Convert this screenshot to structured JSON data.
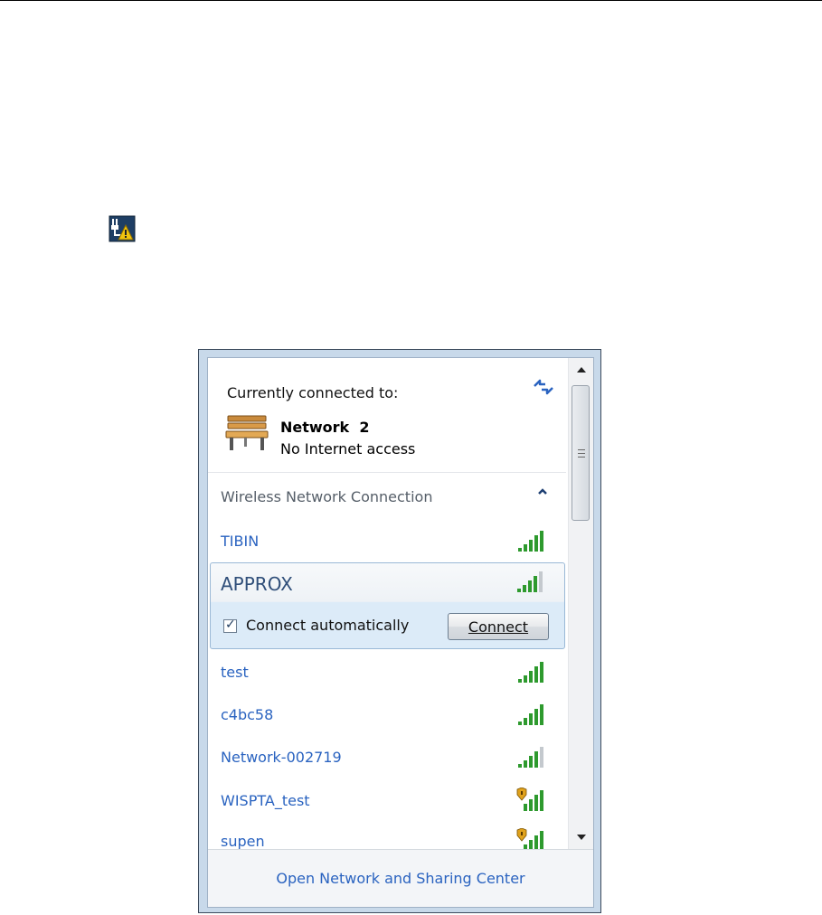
{
  "flyout": {
    "currently_connected_label": "Currently connected to:",
    "current_network": {
      "name": "Network  2",
      "status": "No Internet access"
    },
    "section_title": "Wireless Network Connection",
    "networks": [
      {
        "name": "TIBIN",
        "signal_bars": 5,
        "secured": false
      },
      {
        "name": "APPROX",
        "signal_bars": 4,
        "secured": false,
        "expanded": true,
        "connect_automatically_label": "Connect automatically",
        "connect_automatically_checked": true,
        "connect_button": "Connect"
      },
      {
        "name": "test",
        "signal_bars": 5,
        "secured": false
      },
      {
        "name": "c4bc58",
        "signal_bars": 5,
        "secured": false
      },
      {
        "name": "Network-002719",
        "signal_bars": 4,
        "secured": false
      },
      {
        "name": "WISPTA_test",
        "signal_bars": 5,
        "secured": true
      },
      {
        "name": "supen",
        "signal_bars": 5,
        "secured": true
      }
    ],
    "footer_link": "Open Network and Sharing Center"
  },
  "icons": {
    "tray": "network-warning-icon",
    "refresh": "refresh-icon",
    "current_network": "bench-icon",
    "collapse": "chevron-up-icon",
    "signal": "signal-bars-icon",
    "shield": "shield-icon"
  },
  "colors": {
    "link_blue": "#2a63c0",
    "signal_green": "#2e9a2e",
    "signal_gray": "#c4c9ce",
    "selected_bg": "#dcebf8"
  }
}
